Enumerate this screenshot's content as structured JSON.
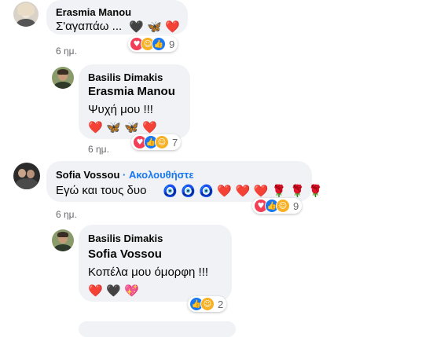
{
  "colors": {
    "accent": "#1877f2",
    "bubble": "#f0f2f5",
    "meta": "#65676b"
  },
  "comments": [
    {
      "author": "Erasmia Manou",
      "text": "Σ'αγαπάω ...",
      "emojis": [
        "🖤",
        "🦋",
        "❤️"
      ],
      "time": "6 ημ.",
      "reactions": [
        "love-icon",
        "care-icon",
        "like-icon"
      ],
      "count": "9"
    },
    {
      "author": "Basilis Dimakis",
      "tag": "Erasmia Manou",
      "text": "Ψυχή μου !!!",
      "emojis": [
        "❤️",
        "🦋",
        "🦋",
        "❤️"
      ],
      "time": "6 ημ.",
      "reactions": [
        "love-icon",
        "like-icon",
        "care-icon"
      ],
      "count": "7"
    },
    {
      "author": "Sofia Vossou",
      "follow": "· Ακολουθήστε",
      "text": "Εγώ και τους δυο",
      "emojis": [
        "🧿",
        "🧿",
        "🧿",
        "❤️",
        "❤️",
        "❤️",
        "🌹",
        "🌹",
        "🌹"
      ],
      "time": "6 ημ.",
      "reactions": [
        "love-icon",
        "like-icon",
        "care-icon"
      ],
      "count": "9"
    },
    {
      "author": "Basilis Dimakis",
      "tag": "Sofia Vossou",
      "text": "Κοπέλα μου όμορφη !!!",
      "emojis": [
        "❤️",
        "🖤",
        "💖"
      ],
      "time": "",
      "reactions": [
        "like-icon",
        "care-icon"
      ],
      "count": "2"
    }
  ]
}
